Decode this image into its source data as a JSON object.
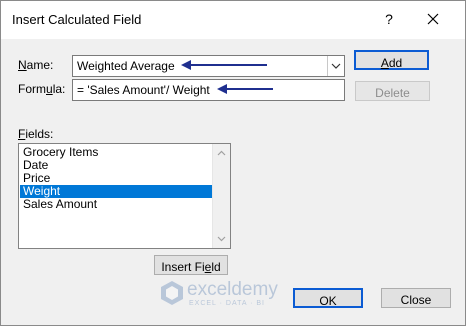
{
  "dialog": {
    "title": "Insert Calculated Field",
    "help_glyph": "?",
    "close_icon": "close-icon"
  },
  "name": {
    "label_pre": "",
    "label_mn": "N",
    "label_post": "ame:",
    "value": "Weighted Average"
  },
  "formula": {
    "label_pre": "Form",
    "label_mn": "u",
    "label_post": "la:",
    "value": "= 'Sales Amount'/ Weight"
  },
  "buttons": {
    "add_mn": "A",
    "add_post": "dd",
    "delete_label": "Delete",
    "insert_pre": "Insert Fi",
    "insert_mn": "e",
    "insert_post": "ld",
    "ok_label": "OK",
    "close_label": "Close"
  },
  "fields": {
    "label_mn": "F",
    "label_post": "ields:",
    "items": [
      "Grocery Items",
      "Date",
      "Price",
      "Weight",
      "Sales Amount"
    ],
    "selected_index": 3
  },
  "watermark": {
    "text": "exceldemy",
    "sub": "EXCEL · DATA · BI"
  },
  "colors": {
    "accent": "#0b5bd3",
    "selection": "#0078d7",
    "annotation_arrow": "#1f2f8f"
  }
}
